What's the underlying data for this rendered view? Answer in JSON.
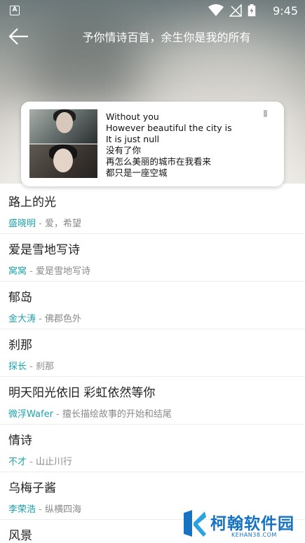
{
  "status_bar": {
    "notification_letter": "A",
    "time": "9:45",
    "icons": [
      "wifi-icon",
      "no-signal-icon",
      "battery-icon"
    ]
  },
  "topbar": {
    "title": "予你情诗百首，余生你是我的所有",
    "back_icon": "arrow-left-icon"
  },
  "lyric_card": {
    "lines": [
      "Without you",
      "However beautiful the city is",
      "It is just null",
      "没有了你",
      "再怎么美丽的城市在我看来",
      "都只是一座空城"
    ]
  },
  "songs": [
    {
      "title": "路上的光",
      "author": "盛晓明",
      "sep": " - ",
      "album": "爱，希望"
    },
    {
      "title": "爱是雪地写诗",
      "author": "窝窝",
      "sep": " - ",
      "album": "爱是雪地写诗"
    },
    {
      "title": "郁岛",
      "author": "金大涛",
      "sep": " - ",
      "album": "佛郡色外"
    },
    {
      "title": "刹那",
      "author": "探长",
      "sep": " - ",
      "album": "刹那"
    },
    {
      "title": "明天阳光依旧 彩虹依然等你",
      "author": "微浮Wafer",
      "sep": " - ",
      "album": "擅长描绘故事的开始和结尾"
    },
    {
      "title": "情诗",
      "author": "不才",
      "sep": " - ",
      "album": "山止川行"
    },
    {
      "title": "乌梅子酱",
      "author": "李荣浩",
      "sep": " - ",
      "album": "纵横四海"
    },
    {
      "title": "风景",
      "author": "",
      "sep": "",
      "album": ""
    }
  ],
  "watermark": {
    "brand": "柯翰软件园",
    "url": "KEHAN38.COM"
  },
  "colors": {
    "author_accent": "#1ea3ad",
    "watermark_blue": "#1673c2"
  }
}
